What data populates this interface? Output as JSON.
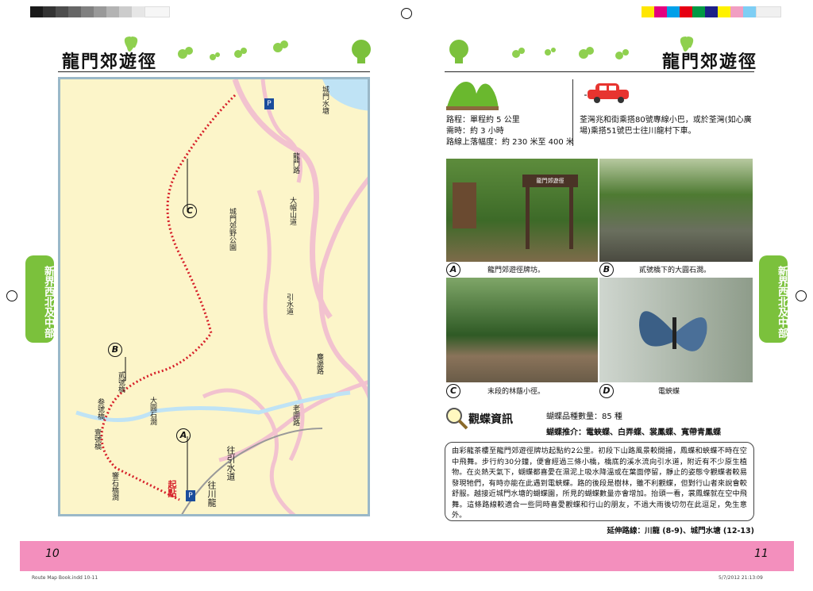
{
  "left_page": {
    "title": "龍門郊遊徑",
    "page_number": "10"
  },
  "right_page": {
    "title": "龍門郊遊徑",
    "page_number": "11"
  },
  "side_tab": {
    "label": "新界西北及中部"
  },
  "route": {
    "distance": "路程：單程約 5 公里",
    "duration": "需時：約 3 小時",
    "elevation": "路線上落幅度：約 230 米至 400 米"
  },
  "transport": {
    "text": "荃灣兆和街乘搭80號專線小巴，或於荃灣(如心廣場)乘搭51號巴士往川龍村下車。"
  },
  "photos": [
    {
      "letter": "A",
      "caption": "龍門郊遊徑牌坊。"
    },
    {
      "letter": "B",
      "caption": "貳號橋下的大圓石澗。"
    },
    {
      "letter": "C",
      "caption": "末段的林蔭小徑。"
    },
    {
      "letter": "D",
      "caption": "電蛺蝶"
    }
  ],
  "sign_text": "龍門郊遊徑",
  "butterfly": {
    "heading": "觀蝶資訊",
    "count": "蝴蝶品種數量：85 種",
    "recommend": "蝴蝶推介：電蛺蝶、白弄蝶、裳鳳蝶、寬帶青鳳蝶"
  },
  "description": "由彩龍茶樓至龍門郊遊徑牌坊起點約2公里。初段下山路風景較開揚，鳳蝶和蛺蝶不時在空中飛舞。步行約30分鐘，便會經過三條小橋，橋底的溪水流向引水道，附近有不少原生植物。在炎熱天氣下，蝴蝶都喜愛在濕泥上吸水降溫或在葉面停留，靜止的姿態令觀蝶者較易發現牠們，有時亦能在此遇到電蛺蝶。路的後段是樹林，雖不利觀蝶，但對行山者來說會較舒服。越接近城門水塘的蝴蝶園，所見的蝴蝶數量亦會增加。抬頭一看，裳鳳蝶就在空中飛舞。這條路線較適合一些同時喜愛觀蝶和行山的朋友，不過大雨後切勿在此逗足，免生意外。",
  "extension": "延伸路線：川龍 (8-9)、城門水塘 (12-13)",
  "map": {
    "labels": {
      "reservoir": "城門水塘",
      "lung_mun": "龍門路",
      "country_park": "城門郊野公園",
      "tai_mo_shan": "大帽山道",
      "catchwater": "引水道",
      "kwun_wo": "麋邊路",
      "lo_wai": "老圍路",
      "bridge2": "貳號橋",
      "bridge3": "叁號橋",
      "bridge1": "壹號橋",
      "big_rock": "大圓石澗",
      "ore_rock": "響石橋澗",
      "start": "起點",
      "to_chuen_lung": "往川龍",
      "to_catchwater": "往引水道"
    },
    "markers": [
      "A",
      "B",
      "C"
    ],
    "parking": "P"
  },
  "file_info": {
    "left": "Route Map Book.indd   10-11",
    "right": "5/7/2012   21:13:09"
  },
  "colors": {
    "green": "#7bc13c",
    "pink": "#f38fbd",
    "route": "#d6202a",
    "river": "#bfe3f5"
  }
}
